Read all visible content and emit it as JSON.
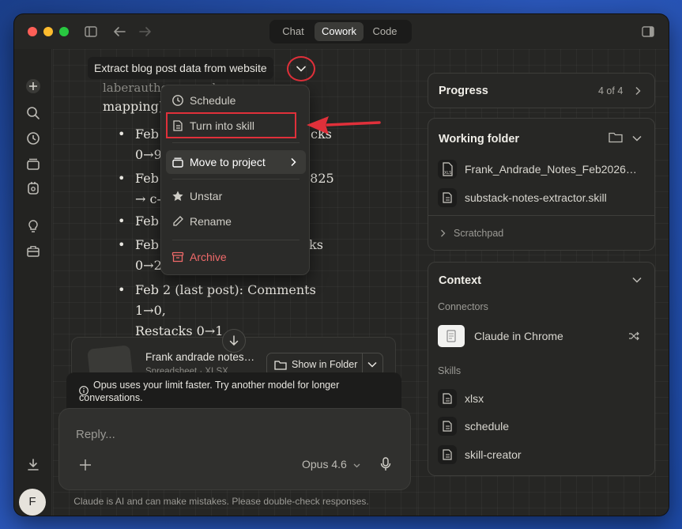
{
  "titlebar": {
    "tabs": [
      {
        "label": "Chat",
        "active": false
      },
      {
        "label": "Cowork",
        "active": true
      },
      {
        "label": "Code",
        "active": false
      }
    ]
  },
  "conversation": {
    "title": "Extract blog post data from website",
    "partial_top": "laberauthor…number",
    "partial_heading": "mapping)",
    "bullets": [
      {
        "line1": "Feb",
        "line1_end": "cks",
        "line2": "0→9"
      },
      {
        "line1": "Feb",
        "line1_end": "8825",
        "line2": "→ c-"
      },
      {
        "line1": "Feb"
      },
      {
        "line1": "Feb",
        "line1_end": "ks",
        "line2": "0→2"
      },
      {
        "line1": "Feb 2 (last post): Comments 1→0,",
        "line2": "Restacks 0→1"
      }
    ],
    "file_card": {
      "name": "Frank andrade notes…",
      "meta": "Spreadsheet · XLSX",
      "show_in_folder": "Show in Folder"
    }
  },
  "menu": {
    "items": [
      {
        "label": "Schedule",
        "icon": "clock-icon"
      },
      {
        "label": "Turn into skill",
        "icon": "skill-icon"
      },
      {
        "label": "Move to project",
        "icon": "folder-stack-icon",
        "submenu": true
      },
      {
        "label": "Unstar",
        "icon": "star-icon"
      },
      {
        "label": "Rename",
        "icon": "pencil-icon"
      },
      {
        "label": "Archive",
        "icon": "archive-icon",
        "danger": true
      }
    ]
  },
  "banner": {
    "text_line1": "Opus uses your limit faster. Try another model for longer",
    "text_line2": "conversations."
  },
  "composer": {
    "placeholder": "Reply...",
    "model": "Opus 4.6"
  },
  "footer": {
    "disclaimer": "Claude is AI and can make mistakes. Please double-check responses."
  },
  "avatar": {
    "initial": "F"
  },
  "progress": {
    "title": "Progress",
    "count": "4 of 4"
  },
  "working_folder": {
    "title": "Working folder",
    "files": [
      {
        "name": "Frank_Andrade_Notes_Feb2026…",
        "icon": "xls-file-icon"
      },
      {
        "name": "substack-notes-extractor.skill",
        "icon": "skill-file-icon"
      }
    ],
    "scratchpad": "Scratchpad"
  },
  "context": {
    "title": "Context",
    "connectors_label": "Connectors",
    "connectors": [
      {
        "name": "Claude in Chrome"
      }
    ],
    "skills_label": "Skills",
    "skills": [
      {
        "name": "xlsx"
      },
      {
        "name": "schedule"
      },
      {
        "name": "skill-creator"
      }
    ]
  },
  "colors": {
    "accent_red": "#e0303a",
    "danger_text": "#f06a6a",
    "window_bg": "#262624"
  }
}
